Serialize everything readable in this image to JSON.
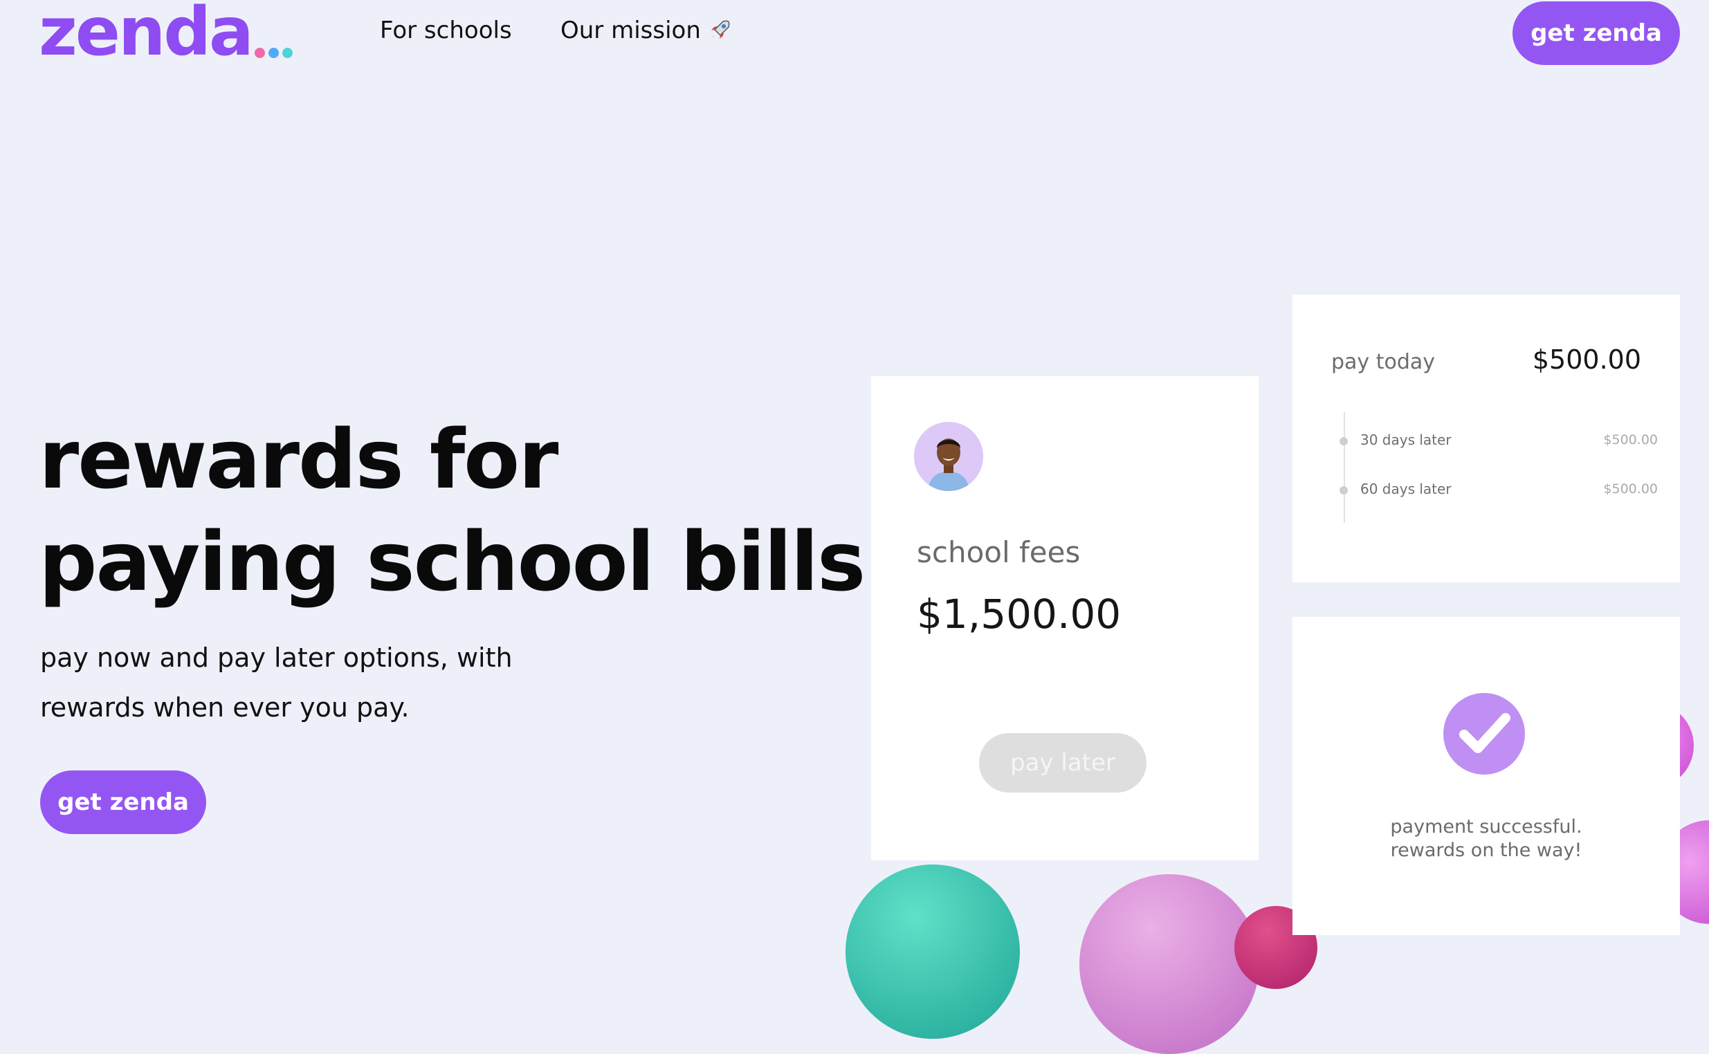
{
  "brand": {
    "logo_text": "zenda",
    "accent": "#8f4cf2",
    "dot_colors": [
      "#f06aa8",
      "#4fa9f7",
      "#4ed3d6"
    ]
  },
  "nav": {
    "for_schools": "For schools",
    "our_mission": "Our mission",
    "mission_icon": "rocket-icon",
    "cta": "get zenda"
  },
  "hero": {
    "title_line1": "rewards for",
    "title_line2": "paying school bills.",
    "subtitle_line1": "pay now and pay later options, with",
    "subtitle_line2": "rewards when ever you pay.",
    "cta": "get zenda"
  },
  "fees_card": {
    "avatar": "person-avatar",
    "label": "school fees",
    "amount": "$1,500.00",
    "button": "pay later"
  },
  "schedule_card": {
    "today_label": "pay today",
    "today_amount": "$500.00",
    "items": [
      {
        "label": "30 days later",
        "amount": "$500.00"
      },
      {
        "label": "60 days later",
        "amount": "$500.00"
      }
    ]
  },
  "success_card": {
    "icon": "checkmark-icon",
    "line1": "payment successful.",
    "line2": "rewards on the way!"
  }
}
